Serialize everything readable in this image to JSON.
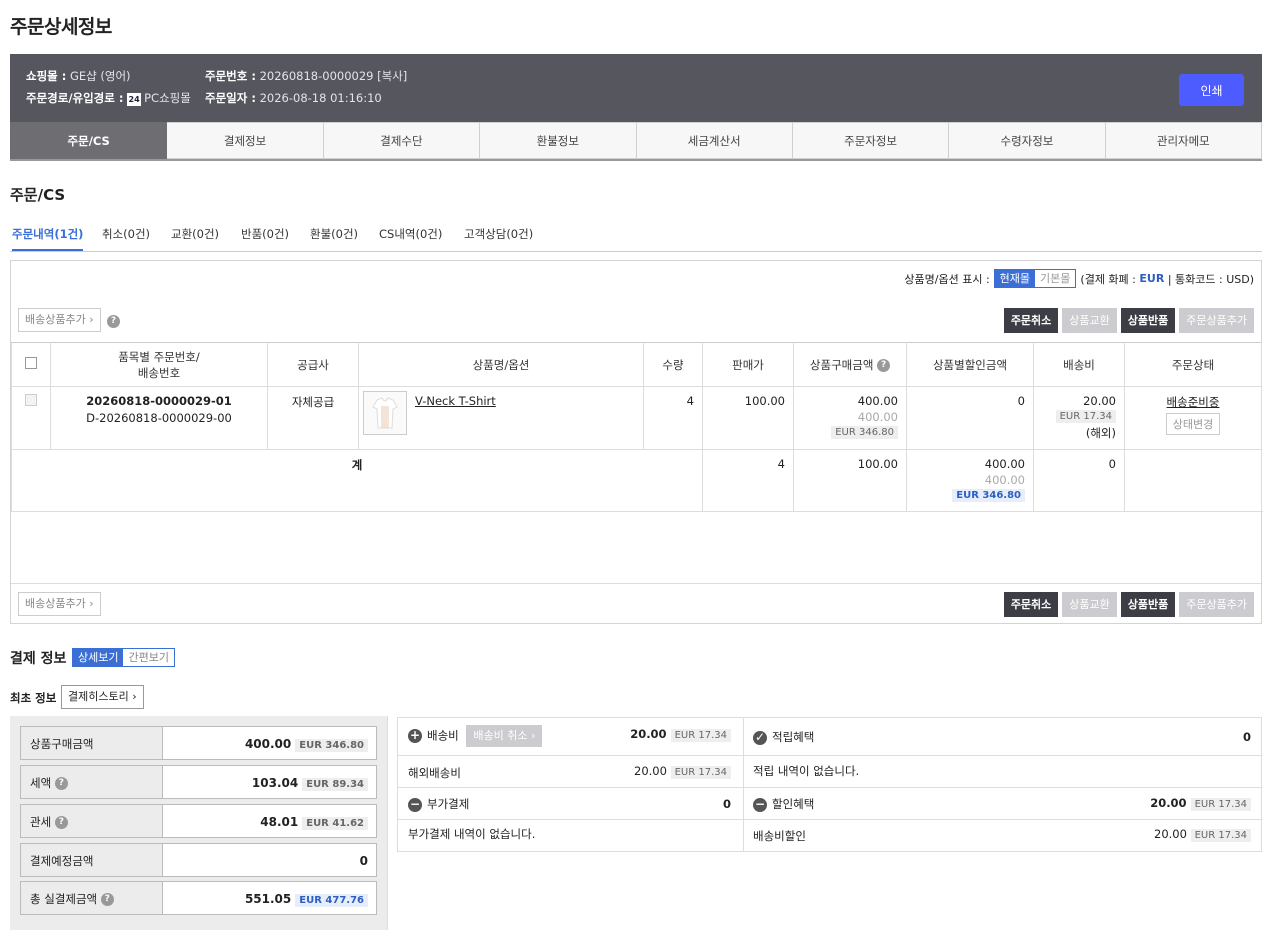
{
  "page": {
    "title": "주문상세정보"
  },
  "info": {
    "mall_label": "쇼핑몰 :",
    "mall_value": "GE샵 (영어)",
    "route_label": "주문경로/유입경로 :",
    "route_badge": "24",
    "route_value": "PC쇼핑몰",
    "order_no_label": "주문번호 :",
    "order_no_value": "20260818-0000029 [복사]",
    "order_date_label": "주문일자 :",
    "order_date_value": "2026-08-18 01:16:10",
    "print_label": "인쇄"
  },
  "main_tabs": [
    "주문/CS",
    "결제정보",
    "결제수단",
    "환불정보",
    "세금계산서",
    "주문자정보",
    "수령자정보",
    "관리자메모"
  ],
  "section_title": "주문/CS",
  "sub_tabs": [
    "주문내역(1건)",
    "취소(0건)",
    "교환(0건)",
    "반품(0건)",
    "환불(0건)",
    "CS내역(0건)",
    "고객상담(0건)"
  ],
  "display_option": {
    "label": "상품명/옵션 표시 :",
    "on": "현재몰",
    "off": "기본몰",
    "currency_prefix": "(결제 화폐 :",
    "currency": "EUR",
    "currency_suffix": "| 통화코드 : USD)"
  },
  "add_delivery_label": "배송상품추가",
  "actions": {
    "cancel": "주문취소",
    "exchange": "상품교환",
    "return": "상품반품",
    "add": "주문상품추가"
  },
  "table": {
    "headers": [
      "품목별 주문번호/\n배송번호",
      "공급사",
      "상품명/옵션",
      "수량",
      "판매가",
      "상품구매금액",
      "상품별할인금액",
      "배송비",
      "주문상태"
    ],
    "row": {
      "order_no": "20260818-0000029-01",
      "delivery_no": "D-20260818-0000029-00",
      "supplier": "자체공급",
      "product": "V-Neck T-Shirt",
      "qty": "4",
      "price": "100.00",
      "amount": "400.00",
      "amount_sub": "400.00",
      "amount_eur": "EUR 346.80",
      "discount": "0",
      "shipping": "20.00",
      "shipping_eur": "EUR 17.34",
      "shipping_note": "(해외)",
      "status": "배송준비중",
      "status_btn": "상태변경"
    },
    "total": {
      "label": "계",
      "qty": "4",
      "price": "100.00",
      "amount": "400.00",
      "amount_sub": "400.00",
      "amount_eur": "EUR 346.80",
      "discount": "0"
    }
  },
  "payment": {
    "title": "결제 정보",
    "detail_view": "상세보기",
    "simple_view": "간편보기",
    "first_info": "최초 정보",
    "history_btn": "결제히스토리",
    "summary": [
      {
        "label": "상품구매금액",
        "value": "400.00",
        "eur": "EUR 346.80"
      },
      {
        "label": "세액",
        "value": "103.04",
        "eur": "EUR 89.34"
      },
      {
        "label": "관세",
        "value": "48.01",
        "eur": "EUR 41.62"
      },
      {
        "label": "결제예정금액",
        "value": "0",
        "eur": ""
      },
      {
        "label": "총 실결제금액",
        "value": "551.05",
        "eur": "EUR 477.76"
      }
    ],
    "shipping_label": "배송비",
    "shipping_cancel": "배송비 취소",
    "shipping_value": "20.00",
    "shipping_eur": "EUR 17.34",
    "overseas_label": "해외배송비",
    "overseas_value": "20.00",
    "overseas_eur": "EUR 17.34",
    "extra_label": "부가결제",
    "extra_value": "0",
    "extra_empty": "부가결제 내역이 없습니다.",
    "points_label": "적립혜택",
    "points_value": "0",
    "points_empty": "적립 내역이 없습니다.",
    "discount_label": "할인혜택",
    "discount_value": "20.00",
    "discount_eur": "EUR 17.34",
    "ship_discount_label": "배송비할인",
    "ship_discount_value": "20.00",
    "ship_discount_eur": "EUR 17.34"
  }
}
